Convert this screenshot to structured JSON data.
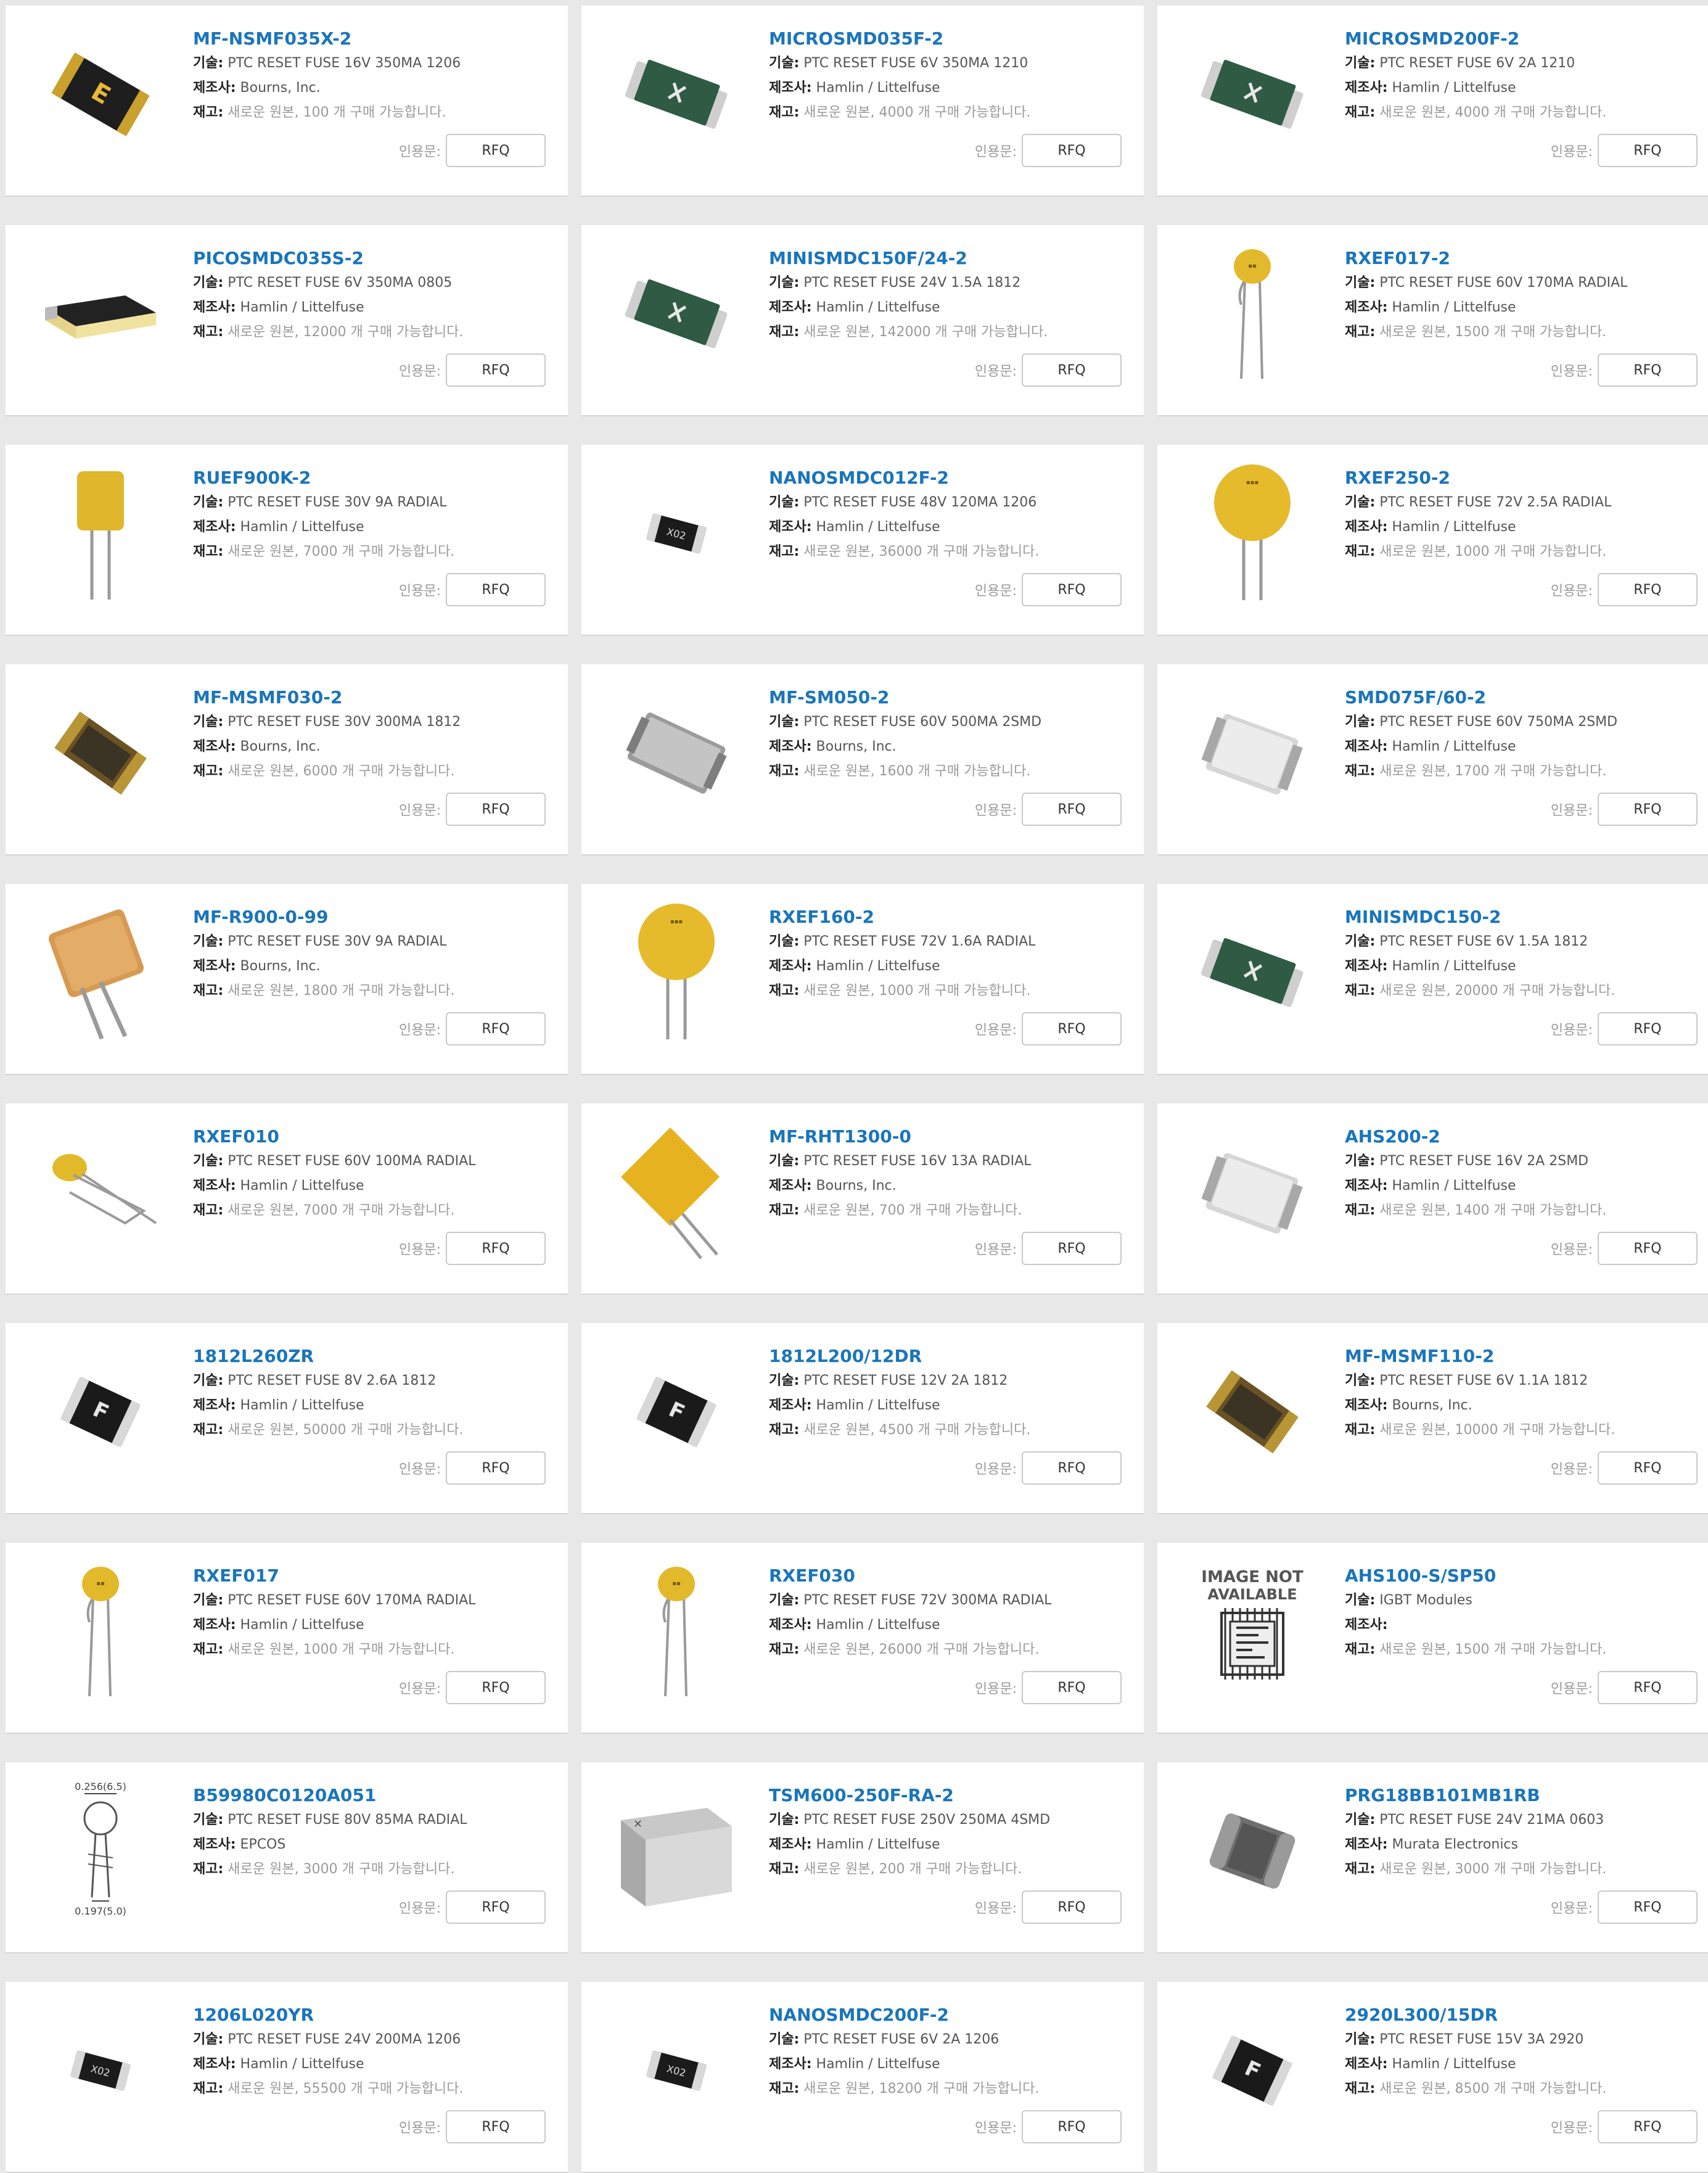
{
  "labels": {
    "desc": "기술:",
    "mfr": "제조사:",
    "stock": "재고:",
    "quote": "인용문:",
    "rfq": "RFQ"
  },
  "products": [
    {
      "name": "MF-NSMF035X-2",
      "desc": "PTC RESET FUSE 16V 350MA 1206",
      "mfr": "Bourns, Inc.",
      "stock": "새로운 원본, 100 개 구매 가능합니다.",
      "icon": "smd-black-e"
    },
    {
      "name": "MICROSMD035F-2",
      "desc": "PTC RESET FUSE 6V 350MA 1210",
      "mfr": "Hamlin / Littelfuse",
      "stock": "새로운 원본, 4000 개 구매 가능합니다.",
      "icon": "smd-green-x"
    },
    {
      "name": "MICROSMD200F-2",
      "desc": "PTC RESET FUSE 6V 2A 1210",
      "mfr": "Hamlin / Littelfuse",
      "stock": "새로운 원본, 4000 개 구매 가능합니다.",
      "icon": "smd-green-x"
    },
    {
      "name": "PICOSMDC035S-2",
      "desc": "PTC RESET FUSE 6V 350MA 0805",
      "mfr": "Hamlin / Littelfuse",
      "stock": "새로운 원본, 12000 개 구매 가능합니다.",
      "icon": "smd-long-black"
    },
    {
      "name": "MINISMDC150F/24-2",
      "desc": "PTC RESET FUSE 24V 1.5A 1812",
      "mfr": "Hamlin / Littelfuse",
      "stock": "새로운 원본, 142000 개 구매 가능합니다.",
      "icon": "smd-green-x"
    },
    {
      "name": "RXEF017-2",
      "desc": "PTC RESET FUSE 60V 170MA RADIAL",
      "mfr": "Hamlin / Littelfuse",
      "stock": "새로운 원본, 1500 개 구매 가능합니다.",
      "icon": "radial-small"
    },
    {
      "name": "RUEF900K-2",
      "desc": "PTC RESET FUSE 30V 9A RADIAL",
      "mfr": "Hamlin / Littelfuse",
      "stock": "새로운 원본, 7000 개 구매 가능합니다.",
      "icon": "radial-rect"
    },
    {
      "name": "NANOSMDC012F-2",
      "desc": "PTC RESET FUSE 48V 120MA 1206",
      "mfr": "Hamlin / Littelfuse",
      "stock": "새로운 원본, 36000 개 구매 가능합니다.",
      "icon": "smd-tiny-black"
    },
    {
      "name": "RXEF250-2",
      "desc": "PTC RESET FUSE 72V 2.5A RADIAL",
      "mfr": "Hamlin / Littelfuse",
      "stock": "새로운 원본, 1000 개 구매 가능합니다.",
      "icon": "radial-big"
    },
    {
      "name": "MF-MSMF030-2",
      "desc": "PTC RESET FUSE 30V 300MA 1812",
      "mfr": "Bourns, Inc.",
      "stock": "새로운 원본, 6000 개 구매 가능합니다.",
      "icon": "smd-brown"
    },
    {
      "name": "MF-SM050-2",
      "desc": "PTC RESET FUSE 60V 500MA 2SMD",
      "mfr": "Bourns, Inc.",
      "stock": "새로운 원본, 1600 개 구매 가능합니다.",
      "icon": "smd-gray-bent"
    },
    {
      "name": "SMD075F/60-2",
      "desc": "PTC RESET FUSE 60V 750MA 2SMD",
      "mfr": "Hamlin / Littelfuse",
      "stock": "새로운 원본, 1700 개 구매 가능합니다.",
      "icon": "smd-silver"
    },
    {
      "name": "MF-R900-0-99",
      "desc": "PTC RESET FUSE 30V 9A RADIAL",
      "mfr": "Bourns, Inc.",
      "stock": "새로운 원본, 1800 개 구매 가능합니다.",
      "icon": "radial-orange-square"
    },
    {
      "name": "RXEF160-2",
      "desc": "PTC RESET FUSE 72V 1.6A RADIAL",
      "mfr": "Hamlin / Littelfuse",
      "stock": "새로운 원본, 1000 개 구매 가능합니다.",
      "icon": "radial-big"
    },
    {
      "name": "MINISMDC150-2",
      "desc": "PTC RESET FUSE 6V 1.5A 1812",
      "mfr": "Hamlin / Littelfuse",
      "stock": "새로운 원본, 20000 개 구매 가능합니다.",
      "icon": "smd-green-x"
    },
    {
      "name": "RXEF010",
      "desc": "PTC RESET FUSE 60V 100MA RADIAL",
      "mfr": "Hamlin / Littelfuse",
      "stock": "새로운 원본, 7000 개 구매 가능합니다.",
      "icon": "radial-bent"
    },
    {
      "name": "MF-RHT1300-0",
      "desc": "PTC RESET FUSE 16V 13A RADIAL",
      "mfr": "Bourns, Inc.",
      "stock": "새로운 원본, 700 개 구매 가능합니다.",
      "icon": "radial-diamond"
    },
    {
      "name": "AHS200-2",
      "desc": "PTC RESET FUSE 16V 2A 2SMD",
      "mfr": "Hamlin / Littelfuse",
      "stock": "새로운 원본, 1400 개 구매 가능합니다.",
      "icon": "smd-silver"
    },
    {
      "name": "1812L260ZR",
      "desc": "PTC RESET FUSE 8V 2.6A 1812",
      "mfr": "Hamlin / Littelfuse",
      "stock": "새로운 원본, 50000 개 구매 가능합니다.",
      "icon": "smd-black-f"
    },
    {
      "name": "1812L200/12DR",
      "desc": "PTC RESET FUSE 12V 2A 1812",
      "mfr": "Hamlin / Littelfuse",
      "stock": "새로운 원본, 4500 개 구매 가능합니다.",
      "icon": "smd-black-f"
    },
    {
      "name": "MF-MSMF110-2",
      "desc": "PTC RESET FUSE 6V 1.1A 1812",
      "mfr": "Bourns, Inc.",
      "stock": "새로운 원본, 10000 개 구매 가능합니다.",
      "icon": "smd-brown"
    },
    {
      "name": "RXEF017",
      "desc": "PTC RESET FUSE 60V 170MA RADIAL",
      "mfr": "Hamlin / Littelfuse",
      "stock": "새로운 원본, 1000 개 구매 가능합니다.",
      "icon": "radial-small"
    },
    {
      "name": "RXEF030",
      "desc": "PTC RESET FUSE 72V 300MA RADIAL",
      "mfr": "Hamlin / Littelfuse",
      "stock": "새로운 원본, 26000 개 구매 가능합니다.",
      "icon": "radial-small"
    },
    {
      "name": "AHS100-S/SP50",
      "desc": "IGBT Modules",
      "mfr": "",
      "stock": "새로운 원본, 1500 개 구매 가능합니다.",
      "icon": "image-not-available",
      "placeholder_line1": "IMAGE NOT",
      "placeholder_line2": "AVAILABLE"
    },
    {
      "name": "B59980C0120A051",
      "desc": "PTC RESET FUSE 80V 85MA RADIAL",
      "mfr": "EPCOS",
      "stock": "새로운 원본, 3000 개 구매 가능합니다.",
      "icon": "radial-drawing",
      "drawing_top": "0.256(6.5)",
      "drawing_bottom": "0.197(5.0)"
    },
    {
      "name": "TSM600-250F-RA-2",
      "desc": "PTC RESET FUSE 250V 250MA 4SMD",
      "mfr": "Hamlin / Littelfuse",
      "stock": "새로운 원본, 200 개 구매 가능합니다.",
      "icon": "smd-gray-block"
    },
    {
      "name": "PRG18BB101MB1RB",
      "desc": "PTC RESET FUSE 24V 21MA 0603",
      "mfr": "Murata Electronics",
      "stock": "새로운 원본, 3000 개 구매 가능합니다.",
      "icon": "smd-chip-gray"
    },
    {
      "name": "1206L020YR",
      "desc": "PTC RESET FUSE 24V 200MA 1206",
      "mfr": "Hamlin / Littelfuse",
      "stock": "새로운 원본, 55500 개 구매 가능합니다.",
      "icon": "smd-tiny-black"
    },
    {
      "name": "NANOSMDC200F-2",
      "desc": "PTC RESET FUSE 6V 2A 1206",
      "mfr": "Hamlin / Littelfuse",
      "stock": "새로운 원본, 18200 개 구매 가능합니다.",
      "icon": "smd-tiny-black"
    },
    {
      "name": "2920L300/15DR",
      "desc": "PTC RESET FUSE 15V 3A 2920",
      "mfr": "Hamlin / Littelfuse",
      "stock": "새로운 원본, 8500 개 구매 가능합니다.",
      "icon": "smd-black-f"
    }
  ]
}
